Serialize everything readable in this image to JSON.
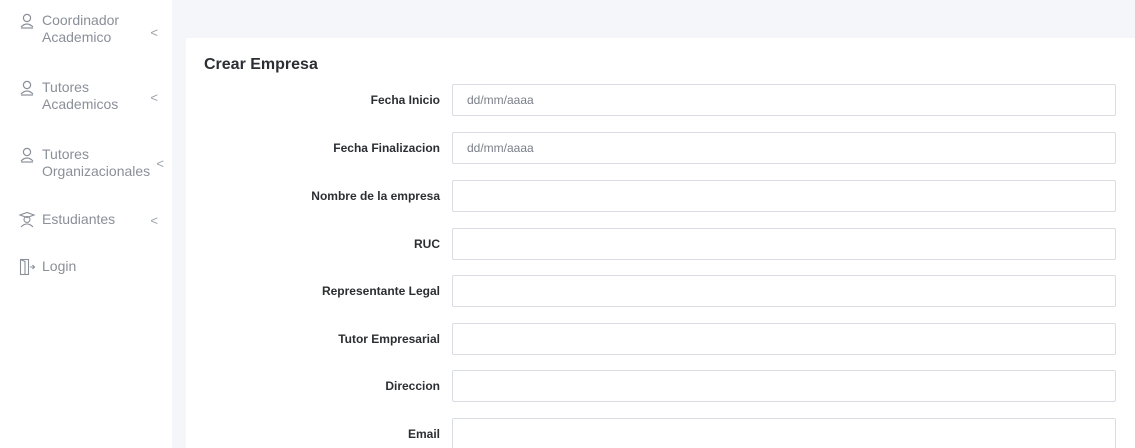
{
  "sidebar": {
    "items": [
      {
        "label": "Coordinador\nAcademico",
        "icon": "person-icon",
        "has_chevron": true
      },
      {
        "label": "Tutores\nAcademicos",
        "icon": "person-icon",
        "has_chevron": true
      },
      {
        "label": "Tutores\nOrganizacionales",
        "icon": "person-icon",
        "has_chevron": true
      },
      {
        "label": "Estudiantes",
        "icon": "student-icon",
        "has_chevron": true
      },
      {
        "label": "Login",
        "icon": "door-exit-icon",
        "has_chevron": false
      }
    ],
    "chevron": "<"
  },
  "form": {
    "title": "Crear Empresa",
    "fields": [
      {
        "label": "Fecha Inicio",
        "placeholder": "dd/mm/aaaa",
        "value": ""
      },
      {
        "label": "Fecha Finalizacion",
        "placeholder": "dd/mm/aaaa",
        "value": ""
      },
      {
        "label": "Nombre de la empresa",
        "placeholder": "",
        "value": ""
      },
      {
        "label": "RUC",
        "placeholder": "",
        "value": ""
      },
      {
        "label": "Representante Legal",
        "placeholder": "",
        "value": ""
      },
      {
        "label": "Tutor Empresarial",
        "placeholder": "",
        "value": ""
      },
      {
        "label": "Direccion",
        "placeholder": "",
        "value": ""
      },
      {
        "label": "Email",
        "placeholder": "",
        "value": ""
      }
    ]
  },
  "colors": {
    "sidebar_text": "#8a8f98",
    "content_background": "#f4f6f9",
    "label_text": "#2b2f33",
    "input_border": "#d9dde2"
  }
}
